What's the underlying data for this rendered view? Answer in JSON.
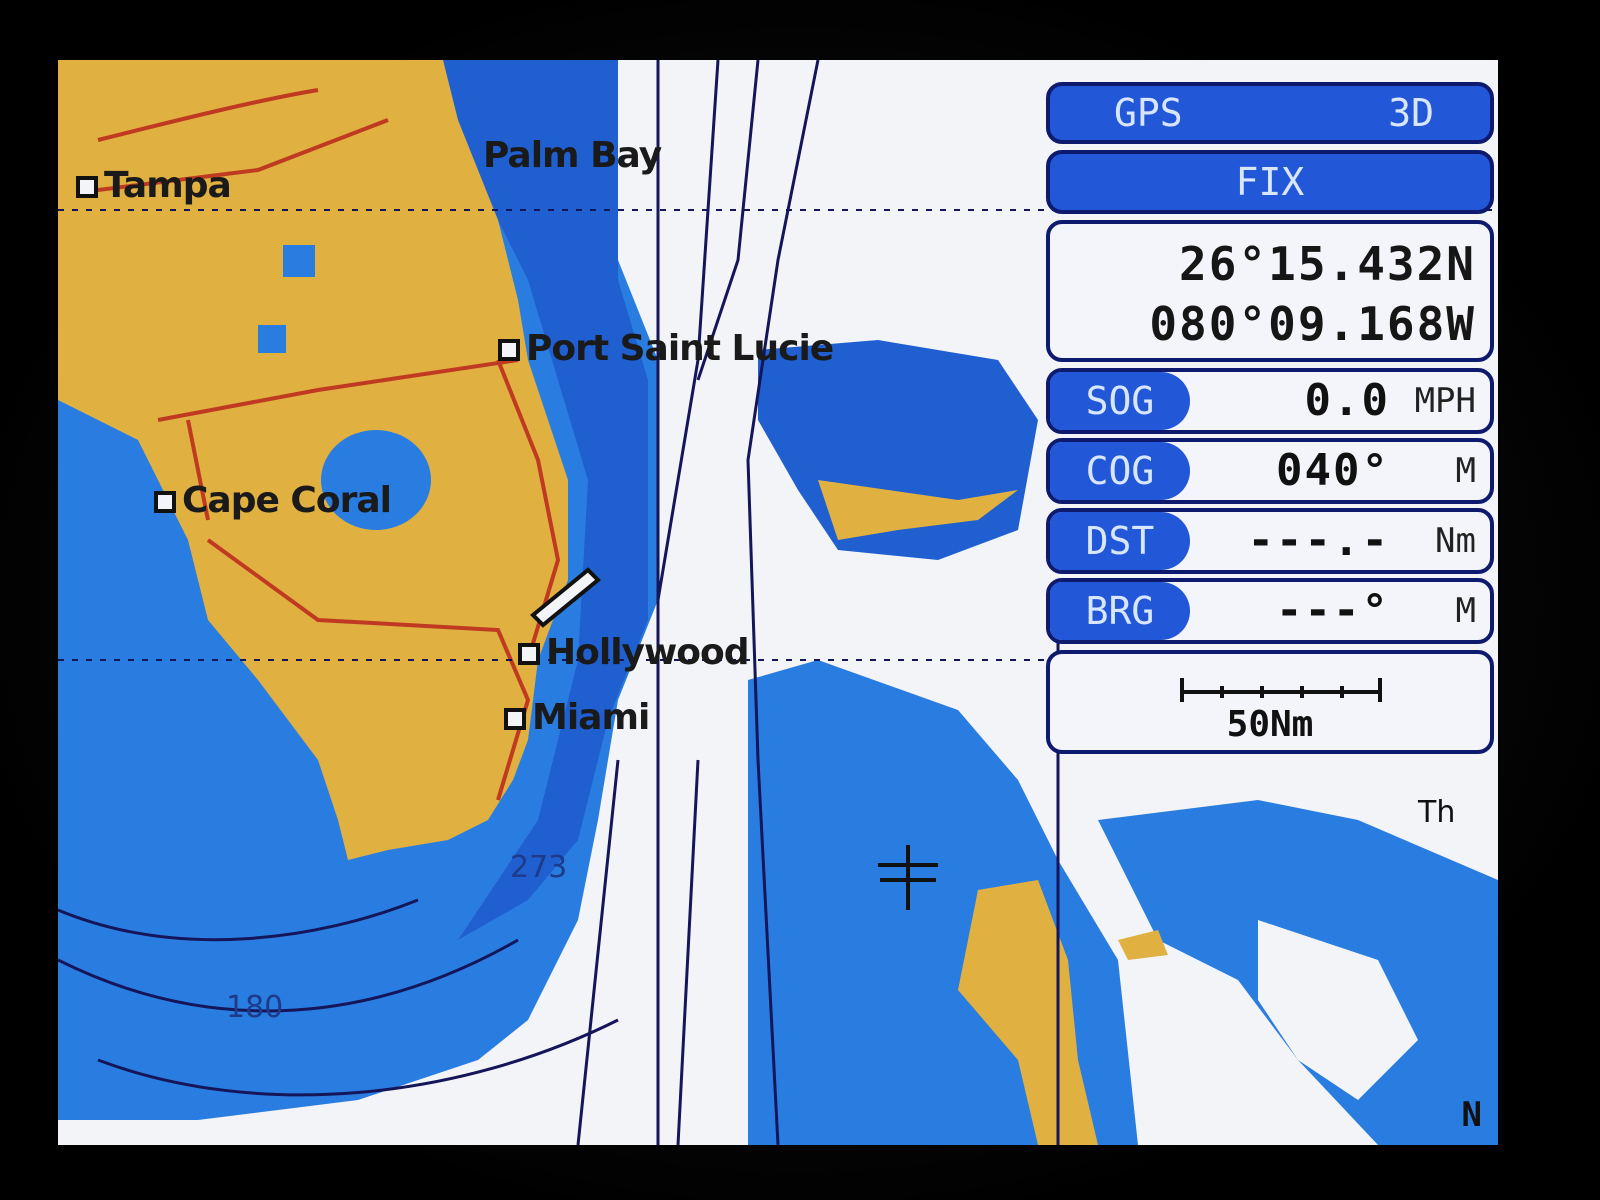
{
  "map": {
    "cities": [
      {
        "name": "Tampa"
      },
      {
        "name": "Palm Bay"
      },
      {
        "name": "Port Saint Lucie"
      },
      {
        "name": "Cape Coral"
      },
      {
        "name": "Hollywood"
      },
      {
        "name": "Miami"
      }
    ],
    "depth_labels": [
      "273",
      "180"
    ],
    "edge_fragment": "Th",
    "colors": {
      "land": "#e0b040",
      "shallow_water": "#2a7de0",
      "deep_water": "#f3f4f8",
      "contour": "#15155a",
      "road": "#c03a22"
    }
  },
  "gps_panel": {
    "gps_label": "GPS",
    "gps_mode": "3D",
    "fix_label": "FIX",
    "latitude": "26°15.432N",
    "longitude": "080°09.168W",
    "rows": [
      {
        "label": "SOG",
        "value": "0.0",
        "unit": "MPH"
      },
      {
        "label": "COG",
        "value": "040°",
        "unit": "M"
      },
      {
        "label": "DST",
        "value": "---.-",
        "unit": "Nm"
      },
      {
        "label": "BRG",
        "value": "---°",
        "unit": "M"
      }
    ],
    "scale_label": "50Nm"
  },
  "orientation": "N"
}
